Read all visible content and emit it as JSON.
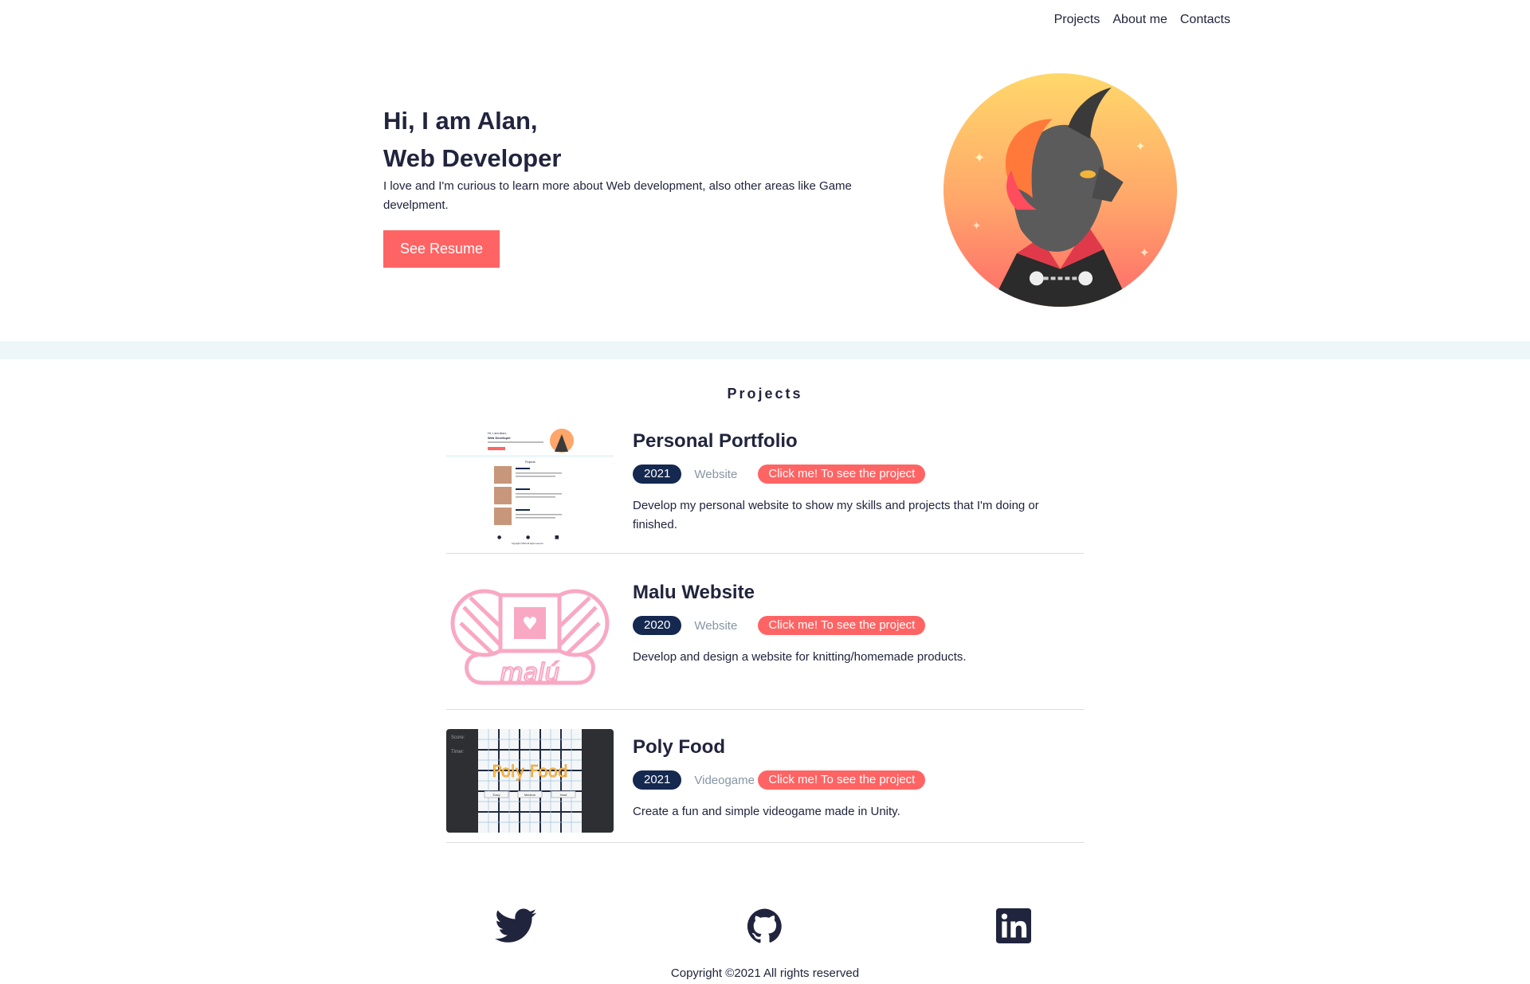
{
  "nav": {
    "items": [
      "Projects",
      "About me",
      "Contacts"
    ]
  },
  "hero": {
    "line1": "Hi, I am Alan,",
    "line2": "Web Developer",
    "description": "I love and I'm curious to learn more about Web development, also other areas like Game develpment.",
    "resume_label": "See Resume",
    "avatar_icon": "dragon-avatar-icon"
  },
  "projects": {
    "heading": "Projects",
    "items": [
      {
        "title": "Personal Portfolio",
        "year": "2021",
        "kind": "Website",
        "link": "Click me! To see the project",
        "description": "Develop my personal website to show my skills and projects that I'm doing or finished.",
        "thumb_mini": {
          "line1": "Hi, I am Alan,",
          "line2": "Web Developer",
          "heading": "Projects",
          "copyright": "Copyright ©2021 All rights reserved"
        }
      },
      {
        "title": "Malu Website",
        "year": "2020",
        "kind": "Website",
        "link": "Click me! To see the project",
        "description": "Develop and design a website for knitting/homemade products.",
        "thumb_logo_text": "malú"
      },
      {
        "title": "Poly Food",
        "year": "2021",
        "kind": "Videogame",
        "link": "Click me! To see the project",
        "description": "Create a fun and simple videogame made in Unity.",
        "thumb_game": {
          "score": "Score:",
          "timer": "Timer:",
          "logo": "Poly Food",
          "buttons": [
            "Easy",
            "Medium",
            "Hard"
          ]
        }
      }
    ]
  },
  "footer": {
    "icons": [
      "twitter-icon",
      "github-icon",
      "linkedin-icon"
    ],
    "copyright": "Copyright ©2021 All rights reserved"
  },
  "colors": {
    "accent": "#ff6464",
    "navy": "#142850",
    "text": "#21243d",
    "muted": "#8695a4",
    "band": "#edf7fa"
  }
}
